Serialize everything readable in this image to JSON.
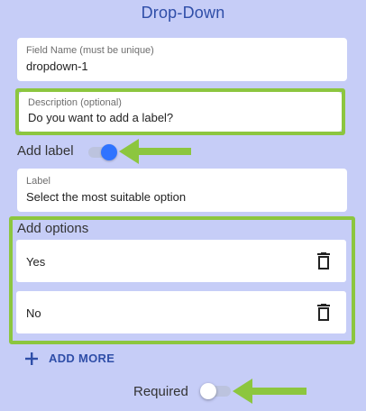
{
  "title": "Drop-Down",
  "field_name": {
    "label": "Field Name (must be unique)",
    "value": "dropdown-1"
  },
  "description": {
    "label": "Description (optional)",
    "value": "Do you want to add a label?"
  },
  "add_label": {
    "text": "Add label",
    "enabled": true
  },
  "label_field": {
    "label": "Label",
    "value": "Select the most suitable option"
  },
  "options_section": {
    "title": "Add options",
    "items": [
      {
        "text": "Yes"
      },
      {
        "text": "No"
      }
    ]
  },
  "add_more": {
    "icon": "plus-icon",
    "text": "ADD MORE"
  },
  "required": {
    "text": "Required",
    "enabled": false
  },
  "colors": {
    "background": "#c6cdf7",
    "accent": "#2f4ea8",
    "toggle_on": "#2f73ff",
    "highlight": "#8cc63f"
  }
}
